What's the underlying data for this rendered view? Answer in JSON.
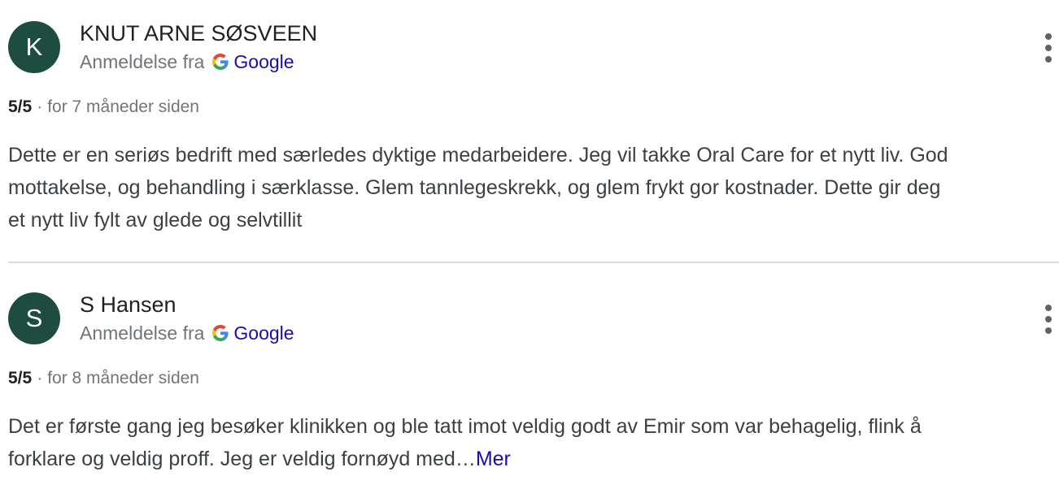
{
  "reviews": [
    {
      "avatar_letter": "K",
      "author": "KNUT ARNE SØSVEEN",
      "source_prefix": "Anmeldelse fra",
      "source_name": "Google",
      "score": "5/5",
      "separator": "·",
      "time": "for 7 måneder siden",
      "text_lines": [
        "Dette er en seriøs bedrift med særledes dyktige medarbeidere. Jeg vil takke Oral Care for et nytt liv. God",
        "mottakelse, og behandling i særklasse. Glem tannlegeskrekk, og glem frykt gor kostnader. Dette gir deg",
        "et nytt liv fylt av glede og selvtillit"
      ]
    },
    {
      "avatar_letter": "S",
      "author": "S Hansen",
      "source_prefix": "Anmeldelse fra",
      "source_name": "Google",
      "score": "5/5",
      "separator": "·",
      "time": "for 8 måneder siden",
      "text_lines": [
        "Det er første gang jeg besøker klinikken og ble tatt imot veldig godt av Emir som var behagelig, flink å",
        "forklare og veldig proff. Jeg er veldig fornøyd med…"
      ],
      "more_label": "Mer"
    }
  ],
  "colors": {
    "avatar_bg": "#1e4d40",
    "link": "#1a0dab",
    "muted": "#70757a"
  },
  "icons": {
    "google_logo": "google-g-icon",
    "more_options": "more-vert-icon"
  }
}
